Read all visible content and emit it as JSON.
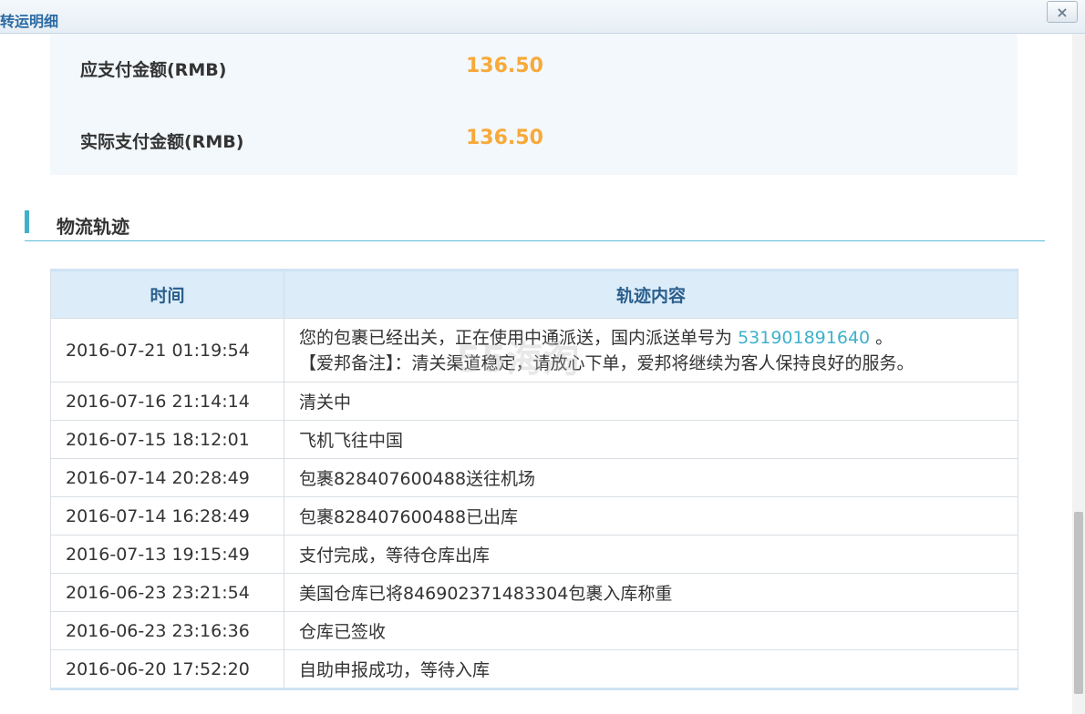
{
  "window": {
    "title": "转运明细",
    "close_label": "×"
  },
  "payment": {
    "due_label": "应支付金额(RMB)",
    "due_value": "136.50",
    "actual_label": "实际支付金额(RMB)",
    "actual_value": "136.50"
  },
  "logistics": {
    "section_title": "物流轨迹",
    "columns": [
      "时间",
      "轨迹内容"
    ],
    "first_row": {
      "time": "2016-07-21 01:19:54",
      "line1_prefix": "您的包裹已经出关，正在使用中通派送，国内派送单号为",
      "tracking_number": "531901891640",
      "line1_suffix": "。",
      "line2": "【爱邦备注】：清关渠道稳定，请放心下单，爱邦将继续为客人保持良好的服务。"
    },
    "rows": [
      {
        "time": "2016-07-16 21:14:14",
        "content": "清关中"
      },
      {
        "time": "2016-07-15 18:12:01",
        "content": "飞机飞往中国"
      },
      {
        "time": "2016-07-14 20:28:49",
        "content": "包裹828407600488送往机场"
      },
      {
        "time": "2016-07-14 16:28:49",
        "content": "包裹828407600488已出库"
      },
      {
        "time": "2016-07-13 19:15:49",
        "content": "支付完成，等待仓库出库"
      },
      {
        "time": "2016-06-23 23:21:54",
        "content": "美国仓库已将846902371483304包裹入库称重"
      },
      {
        "time": "2016-06-23 23:16:36",
        "content": "仓库已签收"
      },
      {
        "time": "2016-06-20 17:52:20",
        "content": "自助申报成功，等待入库"
      }
    ]
  },
  "watermark": "55海淘",
  "colors": {
    "accent": "#3fb1cc",
    "amount": "#f8a93a",
    "header_bg": "#dcecf9",
    "header_text": "#2b5f8d"
  }
}
